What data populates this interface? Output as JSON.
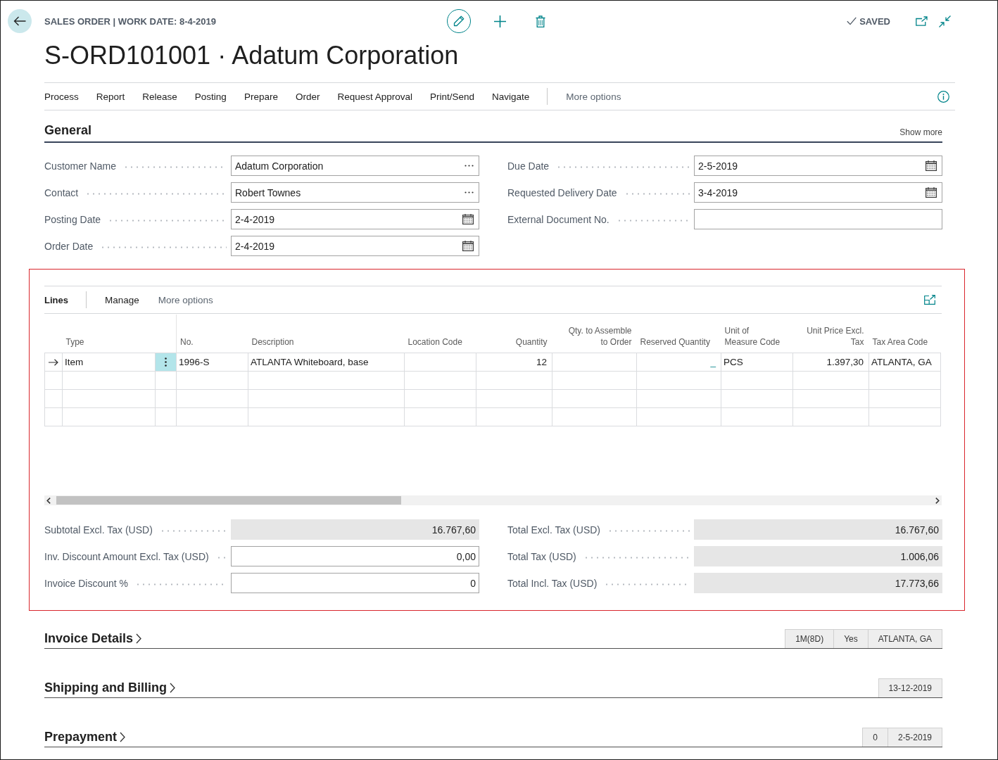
{
  "header": {
    "caption": "SALES ORDER | WORK DATE: 8-4-2019",
    "title": "S-ORD101001 · Adatum Corporation",
    "status": "SAVED"
  },
  "action_bar": {
    "items": [
      "Process",
      "Report",
      "Release",
      "Posting",
      "Prepare",
      "Order",
      "Request Approval",
      "Print/Send",
      "Navigate"
    ],
    "more": "More options"
  },
  "general": {
    "title": "General",
    "show_more": "Show more",
    "left_fields": [
      {
        "label": "Customer Name",
        "value": "Adatum Corporation",
        "kind": "lookup"
      },
      {
        "label": "Contact",
        "value": "Robert Townes",
        "kind": "lookup"
      },
      {
        "label": "Posting Date",
        "value": "2-4-2019",
        "kind": "date"
      },
      {
        "label": "Order Date",
        "value": "2-4-2019",
        "kind": "date"
      }
    ],
    "right_fields": [
      {
        "label": "Due Date",
        "value": "2-5-2019",
        "kind": "date"
      },
      {
        "label": "Requested Delivery Date",
        "value": "3-4-2019",
        "kind": "date"
      },
      {
        "label": "External Document No.",
        "kind": "text"
      }
    ]
  },
  "lines": {
    "title": "Lines",
    "actions": [
      "Manage"
    ],
    "more": "More options",
    "columns": [
      {
        "label": "Type",
        "kind": "text"
      },
      {
        "label": "No.",
        "kind": "text"
      },
      {
        "label": "Description",
        "kind": "text"
      },
      {
        "label": "Location Code",
        "kind": "text"
      },
      {
        "label": "Quantity",
        "kind": "number"
      },
      {
        "label": "Qty. to Assemble to Order",
        "kind": "number"
      },
      {
        "label": "Reserved Quantity",
        "kind": "drilldown"
      },
      {
        "label": "Unit of Measure Code",
        "kind": "text"
      },
      {
        "label": "Unit Price Excl. Tax",
        "kind": "number"
      },
      {
        "label": "Tax Area Code",
        "kind": "text"
      }
    ],
    "rows": [
      {
        "selected": true,
        "cells": [
          "Item",
          "1996-S",
          "ATLANTA Whiteboard, base",
          null,
          "12",
          null,
          "_",
          "PCS",
          "1.397,30",
          "ATLANTA, GA"
        ]
      },
      {
        "selected": false
      },
      {
        "selected": false
      },
      {
        "selected": false
      }
    ],
    "totals_left": [
      {
        "label": "Subtotal Excl. Tax (USD)",
        "value": "16.767,60",
        "editable": false
      },
      {
        "label": "Inv. Discount Amount Excl. Tax (USD)",
        "value": "0,00",
        "editable": true
      },
      {
        "label": "Invoice Discount %",
        "value": "0",
        "editable": true
      }
    ],
    "totals_right": [
      {
        "label": "Total Excl. Tax (USD)",
        "value": "16.767,60",
        "editable": false
      },
      {
        "label": "Total Tax (USD)",
        "value": "1.006,06",
        "editable": false
      },
      {
        "label": "Total Incl. Tax (USD)",
        "value": "17.773,66",
        "editable": false
      }
    ]
  },
  "sections": [
    {
      "title": "Invoice Details",
      "summary": [
        "1M(8D)",
        "Yes",
        "ATLANTA, GA"
      ]
    },
    {
      "title": "Shipping and Billing",
      "summary": [
        "13-12-2019"
      ]
    },
    {
      "title": "Prepayment",
      "summary": [
        "0",
        "2-5-2019"
      ]
    }
  ]
}
